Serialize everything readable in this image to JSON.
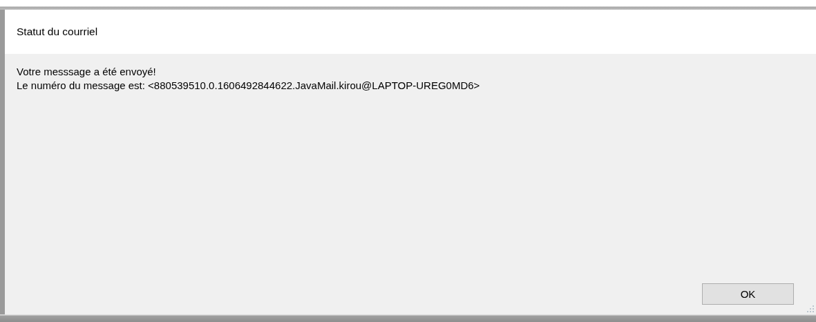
{
  "window": {
    "title": "Statut du courriel"
  },
  "message": {
    "lines": [
      "Votre messsage a été envoyé!",
      "Le numéro du message est: <880539510.0.1606492844622.JavaMail.kirou@LAPTOP-UREG0MD6>"
    ]
  },
  "buttons": [
    "OK"
  ]
}
